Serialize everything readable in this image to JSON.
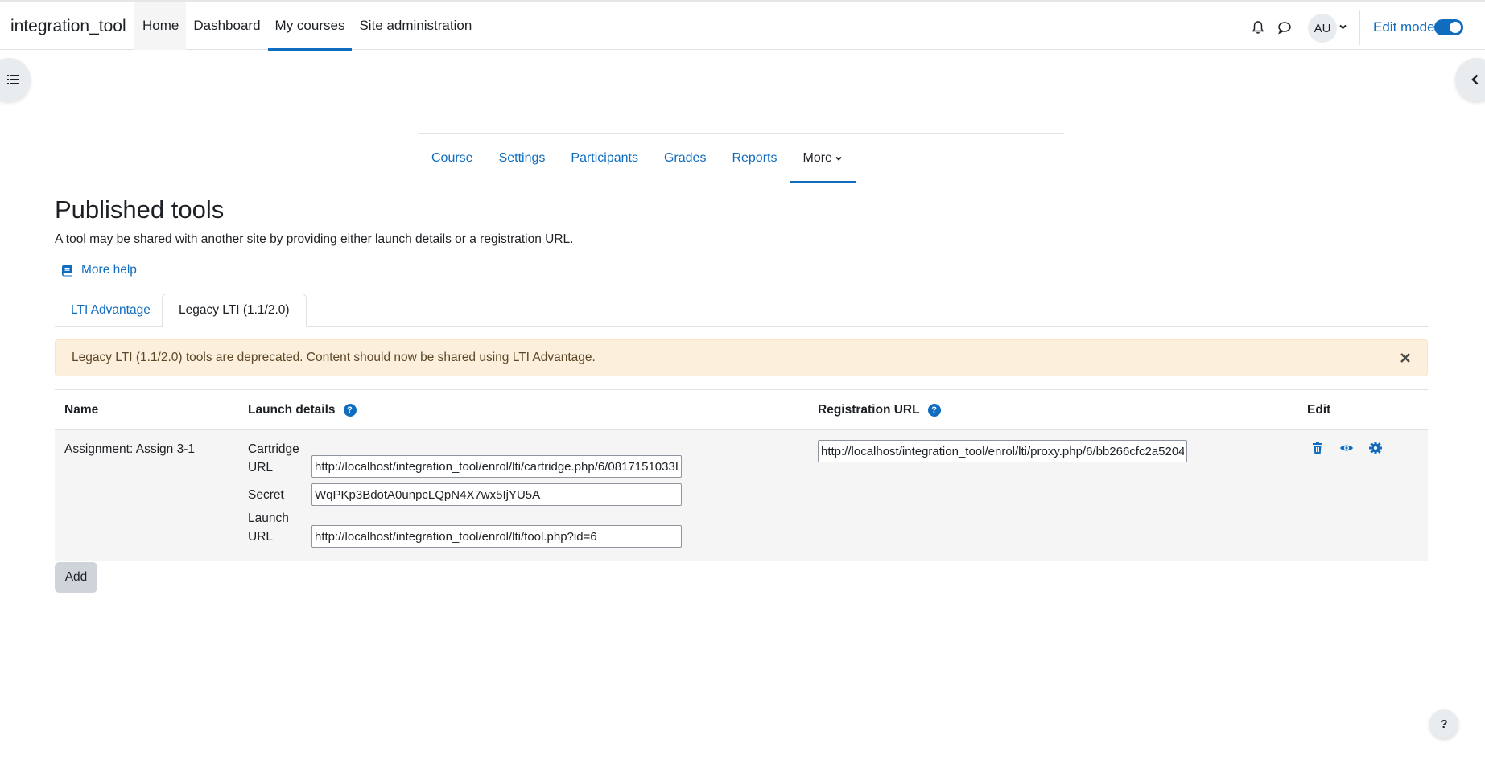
{
  "navbar": {
    "brand": "integration_tool",
    "items": [
      {
        "label": "Home"
      },
      {
        "label": "Dashboard"
      },
      {
        "label": "My courses"
      },
      {
        "label": "Site administration"
      }
    ],
    "avatar_initials": "AU",
    "edit_mode_label": "Edit mode",
    "edit_mode_on": true
  },
  "secondary_nav": {
    "items": [
      {
        "label": "Course"
      },
      {
        "label": "Settings"
      },
      {
        "label": "Participants"
      },
      {
        "label": "Grades"
      },
      {
        "label": "Reports"
      },
      {
        "label": "More"
      }
    ]
  },
  "page": {
    "title": "Published tools",
    "intro": "A tool may be shared with another site by providing either launch details or a registration URL.",
    "help_link": "More help"
  },
  "tabs": [
    {
      "label": "LTI Advantage"
    },
    {
      "label": "Legacy LTI (1.1/2.0)"
    }
  ],
  "alert": {
    "message": "Legacy LTI (1.1/2.0) tools are deprecated. Content should now be shared using LTI Advantage."
  },
  "table": {
    "headers": {
      "name": "Name",
      "launch_details": "Launch details",
      "registration_url": "Registration URL",
      "edit": "Edit"
    },
    "rows": [
      {
        "name": "Assignment: Assign 3-1",
        "cartridge_label_1": "Cartridge",
        "cartridge_label_2": "URL",
        "cartridge_url": "http://localhost/integration_tool/enrol/lti/cartridge.php/6/0817151033I",
        "secret_label": "Secret",
        "secret": "WqPKp3BdotA0unpcLQpN4X7wx5IjYU5A",
        "launch_label_1": "Launch",
        "launch_label_2": "URL",
        "launch_url": "http://localhost/integration_tool/enrol/lti/tool.php?id=6",
        "registration_url": "http://localhost/integration_tool/enrol/lti/proxy.php/6/bb266cfc2a5204"
      }
    ]
  },
  "add_button": "Add",
  "footer_help": "?",
  "colors": {
    "primary": "#0f6cbf",
    "alert_bg": "#fcefdc",
    "row_bg": "#f5f5f5"
  }
}
